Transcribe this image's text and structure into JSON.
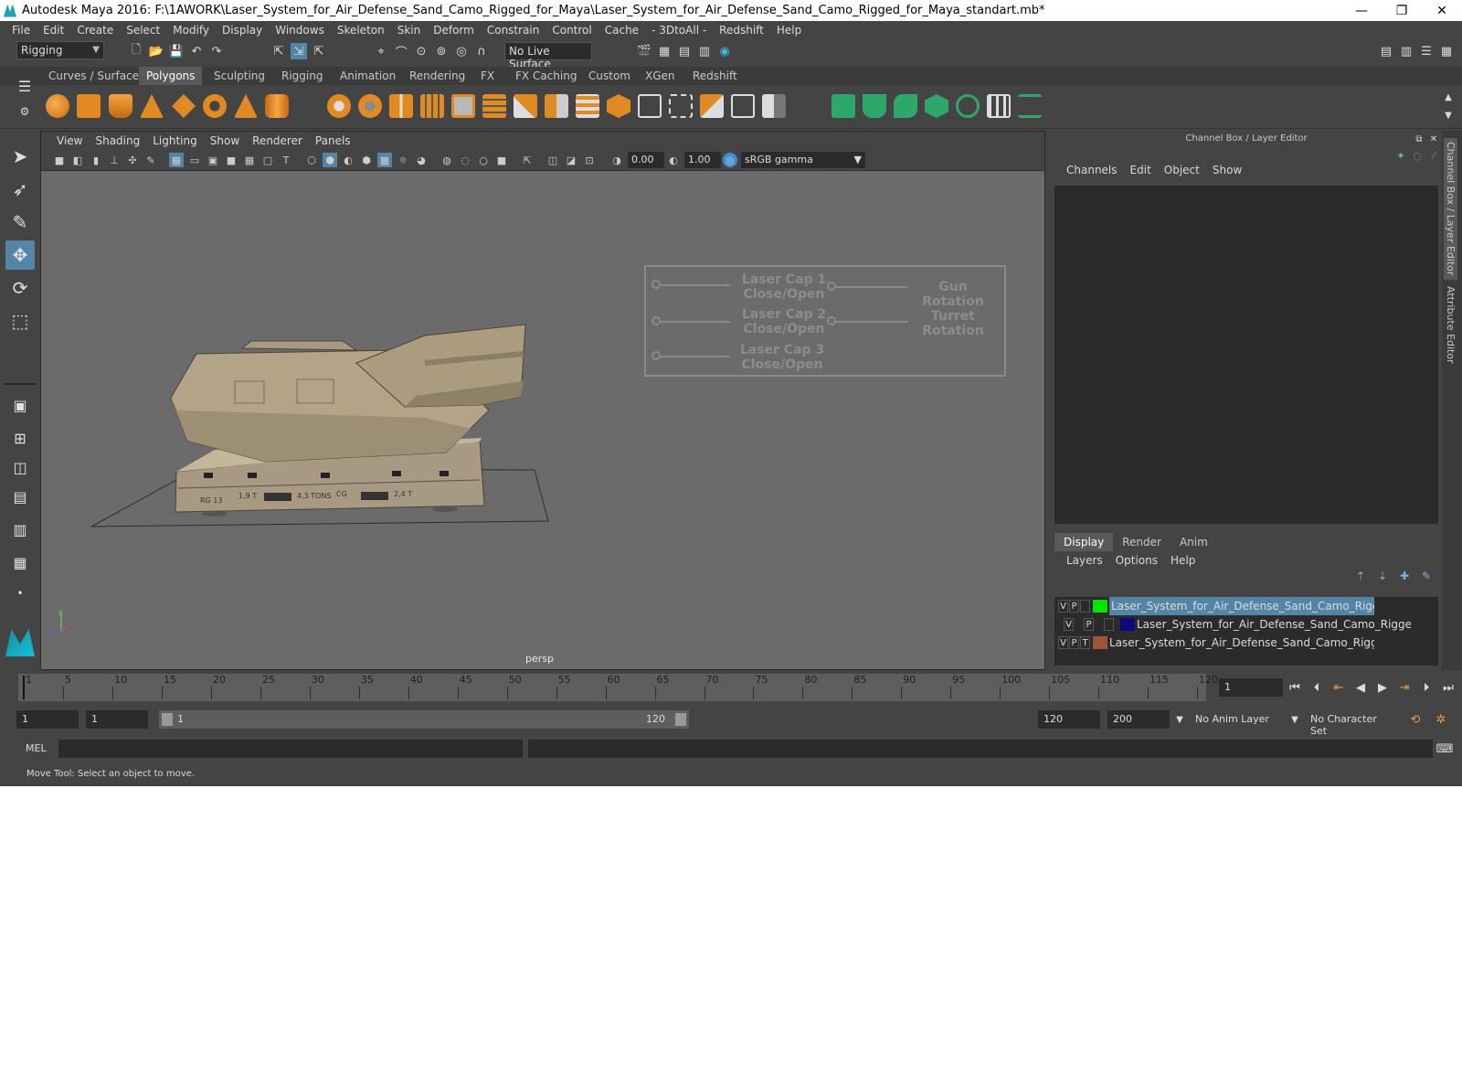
{
  "window": {
    "title": "Autodesk Maya 2016: F:\\1AWORK\\Laser_System_for_Air_Defense_Sand_Camo_Rigged_for_Maya\\Laser_System_for_Air_Defense_Sand_Camo_Rigged_for_Maya_standart.mb*",
    "minimize": "—",
    "restore": "❐",
    "close": "✕"
  },
  "menubar": [
    "File",
    "Edit",
    "Create",
    "Select",
    "Modify",
    "Display",
    "Windows",
    "Skeleton",
    "Skin",
    "Deform",
    "Constrain",
    "Control",
    "Cache",
    "- 3DtoAll -",
    "Redshift",
    "Help"
  ],
  "statusline": {
    "mode": "Rigging",
    "live_surface": "No Live Surface"
  },
  "shelf_tabs": [
    "Curves / Surfaces",
    "Polygons",
    "Sculpting",
    "Rigging",
    "Animation",
    "Rendering",
    "FX",
    "FX Caching",
    "Custom",
    "XGen",
    "Redshift"
  ],
  "shelf_active": "Polygons",
  "viewport": {
    "menu": [
      "View",
      "Shading",
      "Lighting",
      "Show",
      "Renderer",
      "Panels"
    ],
    "exposure": "0.00",
    "gamma": "1.00",
    "colorspace": "sRGB gamma",
    "camera": "persp"
  },
  "model_labels": [
    "RG 13",
    "1,9 T",
    "4,3 TONS",
    "CG",
    "2,4 T"
  ],
  "control_panel": {
    "laser_cap_1": "Laser Cap 1\nClose/Open",
    "laser_cap_2": "Laser Cap 2\nClose/Open",
    "laser_cap_3": "Laser Cap 3\nClose/Open",
    "gun_rotation": "Gun Rotation",
    "turret_rotation": "Turret\nRotation"
  },
  "channel_box": {
    "title": "Channel Box / Layer Editor",
    "menu": [
      "Channels",
      "Edit",
      "Object",
      "Show"
    ]
  },
  "layer_editor": {
    "tabs": [
      "Display",
      "Render",
      "Anim"
    ],
    "active_tab": "Display",
    "menu": [
      "Layers",
      "Options",
      "Help"
    ],
    "layers": [
      {
        "v": "V",
        "p": "P",
        "t": "",
        "color": "#00e600",
        "name": "Laser_System_for_Air_Defense_Sand_Camo_Rigged_conti",
        "selected": true
      },
      {
        "v": "V",
        "p": "P",
        "t": "",
        "color": "#0a0a7a",
        "name": "Laser_System_for_Air_Defense_Sand_Camo_Rigged",
        "selected": false
      },
      {
        "v": "V",
        "p": "P",
        "t": "T",
        "color": "#a0553a",
        "name": "Laser_System_for_Air_Defense_Sand_Camo_Rigged_conti",
        "selected": false
      }
    ]
  },
  "side_tabs": [
    "Channel Box / Layer Editor",
    "Attribute Editor"
  ],
  "timeline": {
    "ticks": [
      1,
      5,
      10,
      15,
      20,
      25,
      30,
      35,
      40,
      45,
      50,
      55,
      60,
      65,
      70,
      75,
      80,
      85,
      90,
      95,
      100,
      105,
      110,
      115,
      120
    ],
    "current_frame": "1"
  },
  "range": {
    "start": "1",
    "start2": "1",
    "slider_start": "1",
    "slider_end": "120",
    "end": "120",
    "end2": "200",
    "anim_layer": "No Anim Layer",
    "char_set": "No Character Set"
  },
  "cmdline": {
    "mode": "MEL"
  },
  "help_line": "Move Tool: Select an object to move."
}
